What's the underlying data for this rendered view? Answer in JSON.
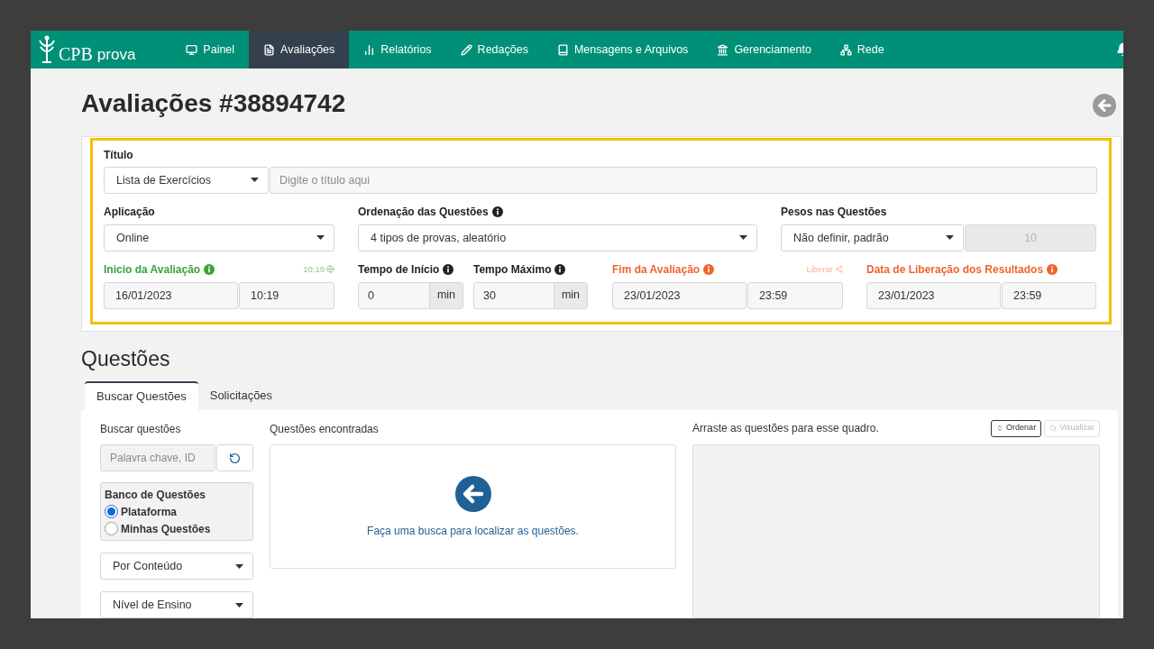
{
  "nav": {
    "logo_brand": "CPB",
    "logo_product": "prova",
    "items": [
      {
        "label": "Painel",
        "selected": false
      },
      {
        "label": "Avaliações",
        "selected": true
      },
      {
        "label": "Relatórios",
        "selected": false
      },
      {
        "label": "Redações",
        "selected": false
      },
      {
        "label": "Mensagens e Arquivos",
        "selected": false
      },
      {
        "label": "Gerenciamento",
        "selected": false
      },
      {
        "label": "Rede",
        "selected": false
      }
    ]
  },
  "page": {
    "title": "Avaliações #38894742"
  },
  "form": {
    "title_field": {
      "label": "Título",
      "type_value": "Lista de Exercícios",
      "placeholder": "Digite o título aqui"
    },
    "application": {
      "label": "Aplicação",
      "value": "Online"
    },
    "ordering": {
      "label": "Ordenação das Questões",
      "value": "4 tipos de provas, aleatório"
    },
    "weights": {
      "label": "Pesos nas Questões",
      "value": "Não definir, padrão",
      "points": "10",
      "points_disabled": true
    },
    "start": {
      "label": "Inicio da Avaliação",
      "hint": "10:19",
      "date": "16/01/2023",
      "time": "10:19"
    },
    "start_time": {
      "label": "Tempo de Início",
      "value": "0",
      "unit": "min"
    },
    "max_time": {
      "label": "Tempo Máximo",
      "value": "30",
      "unit": "min"
    },
    "end": {
      "label": "Fim da Avaliação",
      "action": "Liberar",
      "date": "23/01/2023",
      "time": "23:59"
    },
    "release": {
      "label": "Data de Liberação dos Resultados",
      "date": "23/01/2023",
      "time": "23:59"
    }
  },
  "questions": {
    "heading": "Questões",
    "tabs": [
      {
        "label": "Buscar Questões",
        "selected": true
      },
      {
        "label": "Solicitações",
        "selected": false
      }
    ],
    "search": {
      "label": "Buscar questões",
      "placeholder": "Palavra chave, ID"
    },
    "bank": {
      "label": "Banco de Questões",
      "options": [
        {
          "label": "Plataforma",
          "selected": true
        },
        {
          "label": "Minhas Questões",
          "selected": false
        }
      ]
    },
    "filters": [
      "Por Conteúdo",
      "Nível de Ensino"
    ],
    "found": {
      "label": "Questões encontradas",
      "message": "Faça uma busca para localizar as questões."
    },
    "chosen": {
      "label": "Arraste as questões para esse quadro.",
      "buttons": [
        {
          "label": "Ordenar",
          "disabled": false
        },
        {
          "label": "Visualizar",
          "disabled": true
        }
      ]
    }
  }
}
